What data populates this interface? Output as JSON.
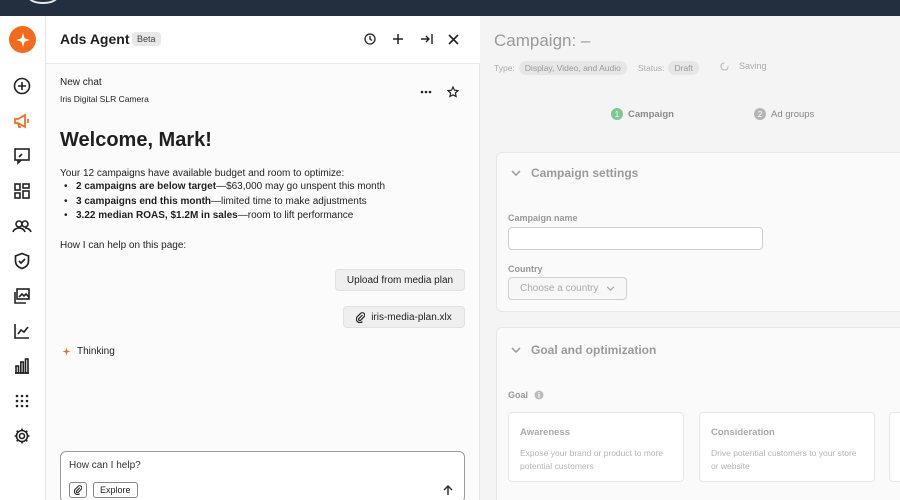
{
  "rail": {
    "items": [
      "add-circle-icon",
      "megaphone-icon",
      "chat-bubble-icon",
      "dashboard-grid-icon",
      "audience-icon",
      "shield-icon",
      "image-gallery-icon",
      "trend-chart-icon",
      "bar-chart-icon",
      "apps-dots-icon",
      "gear-icon"
    ],
    "active": "megaphone-icon",
    "accent": "#f26b1d"
  },
  "chat": {
    "title": "Ads Agent",
    "badge": "Beta",
    "header_icons": [
      "history-icon",
      "plus-icon",
      "collapse-panel-icon",
      "close-icon"
    ],
    "session_title": "New chat",
    "session_subtitle": "Iris Digital SLR Camera",
    "welcome": "Welcome, Mark!",
    "intro": "Your 12 campaigns have available budget and room to optimize:",
    "bullets": [
      {
        "bold": "2 campaigns are below target",
        "rest": "—$63,000 may go unspent this month"
      },
      {
        "bold": "3 campaigns end this month",
        "rest": "—limited time to make adjustments"
      },
      {
        "bold": "3.22 median ROAS, $1.2M in sales",
        "rest": "—room to lift performance"
      }
    ],
    "help_prompt": "How I can help on this page:",
    "user_message": "Upload from media plan",
    "attachment": "iris-media-plan.xlx",
    "status": "Thinking",
    "composer": {
      "placeholder": "How can I help?",
      "explore": "Explore"
    }
  },
  "form": {
    "title": "Campaign: –",
    "type_label": "Type:",
    "type_value": "Display, Video, and Audio",
    "status_label": "Status:",
    "status_value": "Draft",
    "saving": "Saving",
    "steps": [
      {
        "num": "1",
        "label": "Campaign",
        "color": "#7ec894"
      },
      {
        "num": "2",
        "label": "Ad groups",
        "color": "#b5b5b5"
      }
    ],
    "settings": {
      "title": "Campaign settings",
      "name_label": "Campaign name",
      "name_value": "",
      "country_label": "Country",
      "country_placeholder": "Choose a country"
    },
    "goal": {
      "title": "Goal and optimization",
      "goal_label": "Goal",
      "options": [
        {
          "title": "Awareness",
          "desc": "Expose your brand or product to more potential customers"
        },
        {
          "title": "Consideration",
          "desc": "Drive potential customers to your store or website"
        }
      ]
    }
  }
}
